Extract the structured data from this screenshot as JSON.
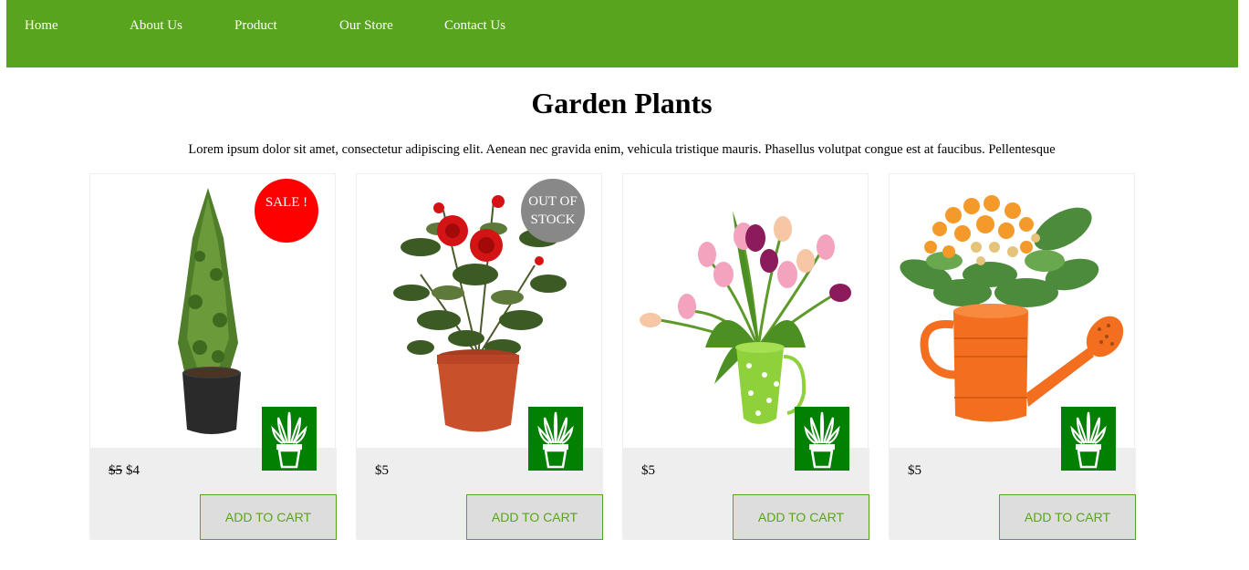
{
  "nav": {
    "items": [
      "Home",
      "About Us",
      "Product",
      "Our Store",
      "Contact Us"
    ]
  },
  "page": {
    "title": "Garden Plants",
    "intro": "Lorem ipsum dolor sit amet, consectetur adipiscing elit. Aenean nec gravida enim, vehicula tristique mauris. Phasellus volutpat congue est at faucibus. Pellentesque"
  },
  "colors": {
    "nav_bg": "#58a41f",
    "sale_badge": "#ff0000",
    "out_of_stock_badge": "#888888",
    "icon_box": "#028002",
    "footer_bg": "#eeeeee"
  },
  "products": [
    {
      "image": "potted-cypress-tree",
      "badge": "SALE !",
      "old_price": "$5",
      "price": "$4",
      "button": "ADD TO CART",
      "icon": "potted-plant-icon"
    },
    {
      "image": "potted-red-rose",
      "badge": "OUT OF STOCK",
      "old_price": "",
      "price": "$5",
      "button": "ADD TO CART",
      "icon": "potted-plant-icon"
    },
    {
      "image": "tulips-in-green-polka-dot-pail",
      "badge": "",
      "old_price": "",
      "price": "$5",
      "button": "ADD TO CART",
      "icon": "potted-plant-icon"
    },
    {
      "image": "kalanchoe-in-orange-watering-can",
      "badge": "",
      "old_price": "",
      "price": "$5",
      "button": "ADD TO CART",
      "icon": "potted-plant-icon"
    }
  ]
}
